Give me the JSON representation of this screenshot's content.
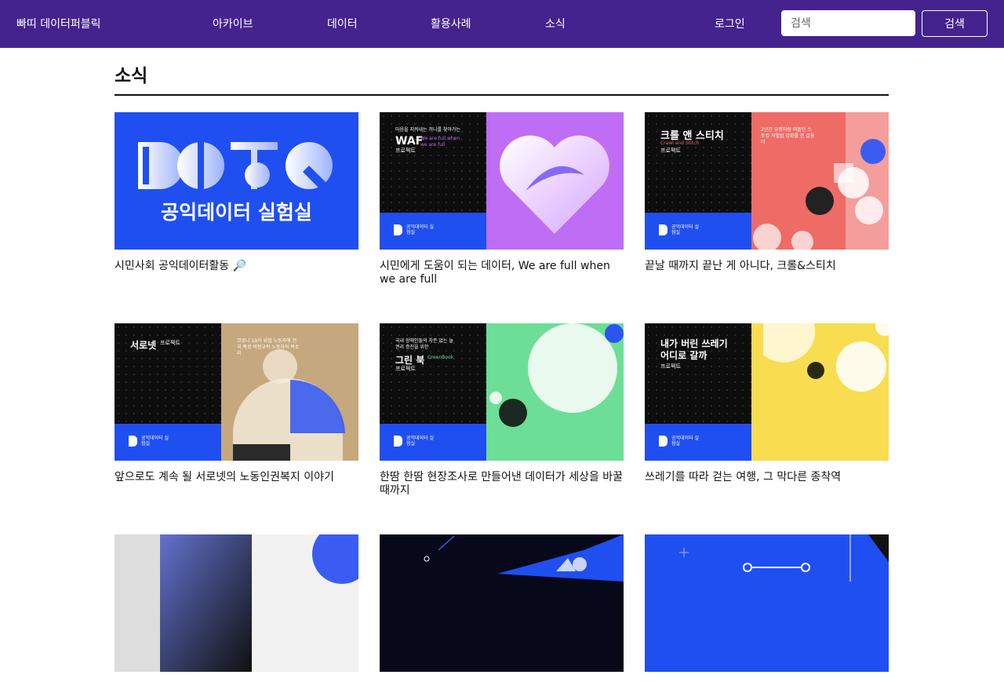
{
  "header": {
    "brand": "빠띠 데이터퍼블릭",
    "nav": [
      "아카이브",
      "데이터",
      "활용사례",
      "소식"
    ],
    "login": "로그인",
    "search_placeholder": "검색",
    "search_button": "검색"
  },
  "section": {
    "title": "소식"
  },
  "cards": [
    {
      "title": "시민사회 공익데이터활동 🔎",
      "thumb": {
        "headline": "공익데이터 실험실"
      }
    },
    {
      "title": "시민에게 도움이 되는 데이터, We are full when we are full",
      "thumb": {
        "kicker": "마음을 지켜내는 끼니를 찾아가는",
        "headline": "WAF",
        "sub": "We are full when we are full",
        "tag": "프로젝트",
        "brand": "공익데이터 실험실"
      }
    },
    {
      "title": "끝날 때까지 끝난 게 아니다, 크롤&스티치",
      "thumb": {
        "headline": "크롤 앤 스티치",
        "sub": "Crawl and Stitch",
        "tag": "프로젝트",
        "note": "2년간 유행처럼 떠돌던 스토킹 처벌법 강화를 한 걸음 더",
        "brand": "공익데이터 실험실"
      }
    },
    {
      "title": "앞으로도 계속 될 서로넷의 노동인권복지 이야기",
      "thumb": {
        "headline": "서로넷",
        "tag": "프로젝트",
        "note": "코로나 19가 위협 노동자에 전국 폭로 비정규직 노동자의 목소리",
        "brand": "공익데이터 실험실"
      }
    },
    {
      "title": "한땀 한땀 현장조사로 만들어낸 데이터가 세상을 바꿀 때까지",
      "thumb": {
        "kicker": "국내 장애인들의 자존 없는 놀 권리 증진을 위한",
        "headline": "그린 북",
        "sub": "GreenBook",
        "tag": "프로젝트",
        "brand": "공익데이터 실험실"
      }
    },
    {
      "title": "쓰레기를 따라 걷는 여행, 그 막다른 종착역",
      "thumb": {
        "headline": "내가 버린 쓰레기 어디로 갈까",
        "tag": "프로젝트",
        "brand": "공익데이터 실험실"
      }
    },
    {
      "title": "",
      "thumb": {}
    },
    {
      "title": "",
      "thumb": {}
    },
    {
      "title": "",
      "thumb": {}
    }
  ],
  "colors": {
    "header": "#45238f",
    "brand_blue": "#1f4ff0",
    "purple": "#c06df5",
    "coral": "#ef6b66",
    "tan": "#c6a87e",
    "green": "#6cde96",
    "yellow": "#f7dd4f"
  }
}
